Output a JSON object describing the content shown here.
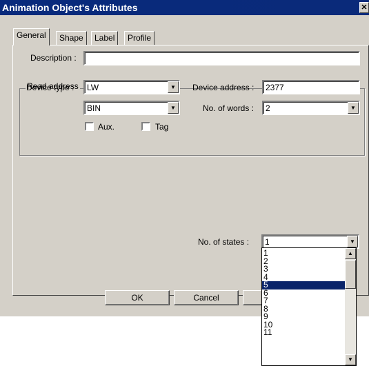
{
  "window": {
    "title": "Animation Object's Attributes",
    "close_glyph": "✕"
  },
  "tabs": [
    {
      "label": "General"
    },
    {
      "label": "Shape"
    },
    {
      "label": "Label"
    },
    {
      "label": "Profile"
    }
  ],
  "general": {
    "description_label": "Description :",
    "description_value": "",
    "read_address_title": "Read address",
    "device_type_label": "Device type :",
    "device_type_value": "LW",
    "format_value": "BIN",
    "device_address_label": "Device address :",
    "device_address_value": "2377",
    "no_of_words_label": "No. of words :",
    "no_of_words_value": "2",
    "aux_label": "Aux.",
    "tag_label": "Tag",
    "no_of_states_label": "No. of states :",
    "no_of_states_value": "1"
  },
  "dropdown": {
    "options": [
      "1",
      "2",
      "3",
      "4",
      "5",
      "6",
      "7",
      "8",
      "9",
      "10",
      "11"
    ],
    "selected": "5"
  },
  "buttons": {
    "ok": "OK",
    "cancel": "Cancel"
  },
  "icons": {
    "combo_arrow": "▼",
    "scroll_up": "▲",
    "scroll_down": "▼"
  }
}
